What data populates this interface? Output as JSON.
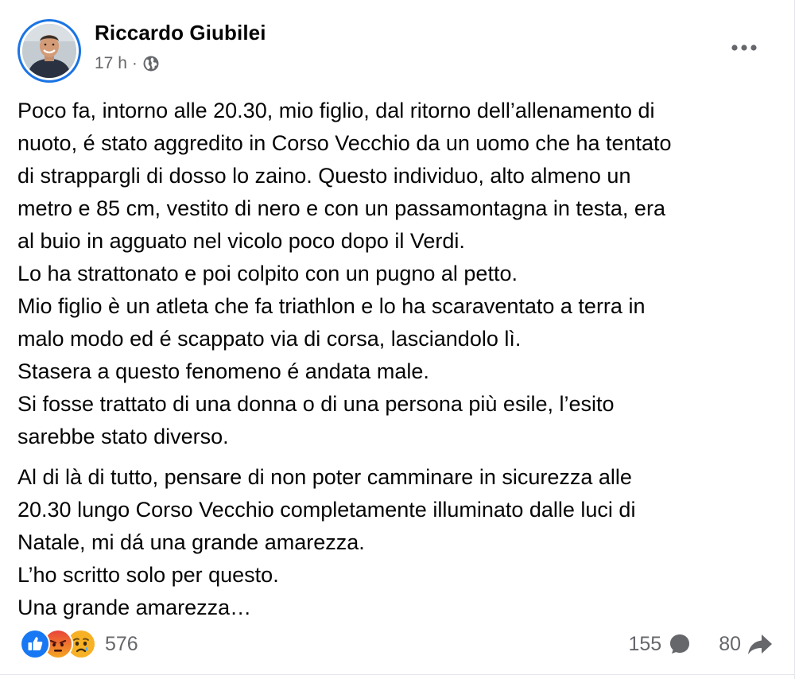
{
  "post": {
    "author": "Riccardo Giubilei",
    "time": "17 h",
    "separator": "·",
    "privacy_icon": "globe-icon",
    "more_icon": "more-options-icon",
    "paragraph1_lines": [
      "Poco fa, intorno alle 20.30, mio figlio, dal ritorno dell’allenamento di",
      "nuoto, é stato aggredito in Corso Vecchio da un uomo che ha tentato",
      "di strappargli di dosso lo zaino. Questo individuo, alto almeno un",
      "metro e 85 cm, vestito di nero e con un passamontagna in testa, era",
      "al buio in agguato nel vicolo poco dopo il Verdi.",
      "Lo ha strattonato e poi colpito con un pugno al petto.",
      "Mio figlio è un atleta che fa triathlon e lo ha scaraventato a terra in",
      "malo modo ed é scappato via di corsa, lasciandolo lì.",
      "Stasera a questo fenomeno é andata male.",
      "Si fosse trattato di una donna o di una persona più esile, l’esito",
      "sarebbe stato diverso."
    ],
    "paragraph2_lines": [
      "Al di là di tutto, pensare di non poter camminare in sicurezza alle",
      "20.30 lungo Corso Vecchio completamente illuminato dalle luci di",
      "Natale, mi dá una grande amarezza.",
      "L’ho scritto solo per questo.",
      "Una grande amarezza…"
    ]
  },
  "footer": {
    "reaction_icons": [
      "like-reaction-icon",
      "angry-reaction-icon",
      "sad-reaction-icon"
    ],
    "reaction_count": "576",
    "comment_count": "155",
    "share_count": "80",
    "colors": {
      "like": "#1877f2",
      "angry": "#e9710f",
      "sad": "#f7b125",
      "meta": "#65676b"
    }
  }
}
